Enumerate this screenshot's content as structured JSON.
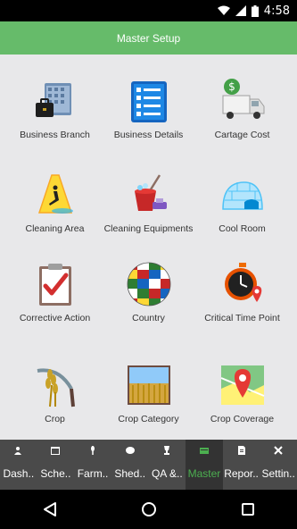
{
  "status": {
    "time": "4:58"
  },
  "appbar": {
    "title": "Master Setup"
  },
  "tiles": [
    {
      "label": "Business Branch",
      "icon": "office-building-icon"
    },
    {
      "label": "Business Details",
      "icon": "checklist-icon"
    },
    {
      "label": "Cartage Cost",
      "icon": "delivery-truck-icon"
    },
    {
      "label": "Cleaning Area",
      "icon": "wet-floor-sign-icon"
    },
    {
      "label": "Cleaning Equipments",
      "icon": "cleaning-bucket-icon"
    },
    {
      "label": "Cool Room",
      "icon": "igloo-icon"
    },
    {
      "label": "Corrective Action",
      "icon": "clipboard-check-icon"
    },
    {
      "label": "Country",
      "icon": "flag-globe-icon"
    },
    {
      "label": "Critical Time Point",
      "icon": "stopwatch-map-icon"
    },
    {
      "label": "Crop",
      "icon": "wheat-sickle-icon"
    },
    {
      "label": "Crop Category",
      "icon": "wheat-field-icon"
    },
    {
      "label": "Crop Coverage",
      "icon": "map-pin-icon"
    }
  ],
  "nav": [
    {
      "label": "Dash..",
      "icon": "dashboard-icon"
    },
    {
      "label": "Sche..",
      "icon": "schedule-icon"
    },
    {
      "label": "Farm..",
      "icon": "farm-icon"
    },
    {
      "label": "Shed..",
      "icon": "shed-icon"
    },
    {
      "label": "QA &..",
      "icon": "qa-icon"
    },
    {
      "label": "Master",
      "icon": "master-icon"
    },
    {
      "label": "Repor..",
      "icon": "report-icon"
    },
    {
      "label": "Settin..",
      "icon": "settings-icon"
    }
  ],
  "colors": {
    "appbar": "#66bb6a",
    "nav_bg": "#4a4a4a",
    "nav_active": "#4caf50"
  }
}
